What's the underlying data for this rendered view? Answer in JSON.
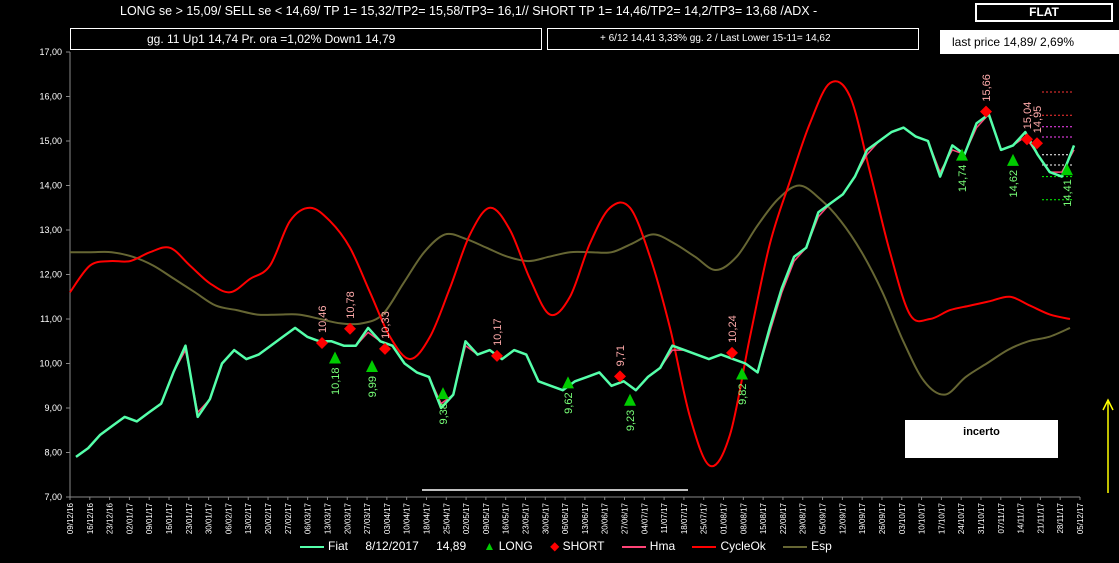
{
  "header": {
    "signal_text": "LONG se > 15,09/   SELL se < 14,69/ TP 1= 15,32/TP2= 15,58/TP3= 16,1//   SHORT  TP 1= 14,46/TP2= 14,2/TP3= 13,68 /ADX -",
    "status": "FLAT"
  },
  "info1": "gg. 11 Up1  14,74  Pr. ora =1,02%   Down1  14,79",
  "info2": "+ 6/12   14,41  3,33%  gg. 2 / Last Lower 15-11= 14,62",
  "last_price": "last price 14,89/  2,69%",
  "incerto_label": "incerto",
  "colors": {
    "price": "#55ffaa",
    "long": "#00cc00",
    "short": "#ff0000",
    "hma": "#ff4477",
    "cycleok": "#ff0000",
    "esp": "#666633",
    "long_label": "#77ff77",
    "short_label": "#ffaaaa"
  },
  "chart_data": {
    "type": "line",
    "ylim": [
      7.0,
      17.0
    ],
    "yticks": [
      "7,00",
      "8,00",
      "9,00",
      "10,00",
      "11,00",
      "12,00",
      "13,00",
      "14,00",
      "15,00",
      "16,00",
      "17,00"
    ],
    "xtick_labels": [
      "09/12/16",
      "16/12/16",
      "23/12/16",
      "02/01/17",
      "09/01/17",
      "16/01/17",
      "23/01/17",
      "30/01/17",
      "06/02/17",
      "13/02/17",
      "20/02/17",
      "27/02/17",
      "06/03/17",
      "13/03/17",
      "20/03/17",
      "27/03/17",
      "03/04/17",
      "10/04/17",
      "18/04/17",
      "25/04/17",
      "02/05/17",
      "09/05/17",
      "16/05/17",
      "23/05/17",
      "30/05/17",
      "06/06/17",
      "13/06/17",
      "20/06/17",
      "27/06/17",
      "04/07/17",
      "11/07/17",
      "18/07/17",
      "25/07/17",
      "01/08/17",
      "08/08/17",
      "15/08/17",
      "22/08/17",
      "29/08/17",
      "05/09/17",
      "12/09/17",
      "19/09/17",
      "26/09/17",
      "03/10/17",
      "10/10/17",
      "17/10/17",
      "24/10/17",
      "31/10/17",
      "07/11/17",
      "14/11/17",
      "21/11/17",
      "28/11/17",
      "05/12/17"
    ],
    "series": [
      {
        "name": "Fiat",
        "values": [
          7.9,
          8.1,
          8.4,
          8.6,
          8.8,
          8.7,
          8.9,
          9.1,
          9.8,
          10.4,
          8.8,
          9.2,
          10.0,
          10.3,
          10.1,
          10.2,
          10.4,
          10.6,
          10.8,
          10.6,
          10.5,
          10.5,
          10.4,
          10.4,
          10.8,
          10.5,
          10.4,
          10.0,
          9.8,
          9.7,
          9.0,
          9.3,
          10.5,
          10.2,
          10.3,
          10.1,
          10.3,
          10.2,
          9.6,
          9.5,
          9.4,
          9.6,
          9.7,
          9.8,
          9.5,
          9.6,
          9.4,
          9.7,
          9.9,
          10.4,
          10.3,
          10.2,
          10.1,
          10.2,
          10.1,
          10.0,
          9.8,
          10.8,
          11.7,
          12.4,
          12.6,
          13.4,
          13.6,
          13.8,
          14.2,
          14.8,
          15.0,
          15.2,
          15.3,
          15.1,
          15.0,
          14.2,
          14.9,
          14.7,
          15.4,
          15.6,
          14.8,
          14.9,
          15.2,
          14.7,
          14.3,
          14.2,
          14.9
        ]
      },
      {
        "name": "Hma",
        "values": [
          7.9,
          8.1,
          8.4,
          8.6,
          8.8,
          8.7,
          8.9,
          9.1,
          9.8,
          10.3,
          8.9,
          9.2,
          10.0,
          10.3,
          10.1,
          10.2,
          10.4,
          10.6,
          10.8,
          10.6,
          10.5,
          10.5,
          10.4,
          10.4,
          10.7,
          10.5,
          10.4,
          10.0,
          9.8,
          9.7,
          9.1,
          9.3,
          10.4,
          10.2,
          10.3,
          10.1,
          10.3,
          10.2,
          9.6,
          9.5,
          9.4,
          9.6,
          9.7,
          9.8,
          9.5,
          9.6,
          9.4,
          9.7,
          9.9,
          10.3,
          10.3,
          10.2,
          10.1,
          10.2,
          10.1,
          10.0,
          9.8,
          10.7,
          11.6,
          12.3,
          12.6,
          13.3,
          13.6,
          13.8,
          14.2,
          14.7,
          15.0,
          15.2,
          15.3,
          15.1,
          15.0,
          14.3,
          14.8,
          14.7,
          15.3,
          15.6,
          14.8,
          14.9,
          15.1,
          14.7,
          14.3,
          14.3,
          14.8
        ]
      },
      {
        "name": "CycleOk",
        "values": [
          11.6,
          12.2,
          12.3,
          12.3,
          12.5,
          12.6,
          12.2,
          11.8,
          11.6,
          11.9,
          12.2,
          13.2,
          13.5,
          13.2,
          12.6,
          11.6,
          10.6,
          10.1,
          10.6,
          11.7,
          12.9,
          13.5,
          13.0,
          11.9,
          11.1,
          11.5,
          12.7,
          13.5,
          13.5,
          12.4,
          10.8,
          8.8,
          7.7,
          8.4,
          10.6,
          12.7,
          14.1,
          15.4,
          16.3,
          16.0,
          14.3,
          12.5,
          11.1,
          11.0,
          11.2,
          11.3,
          11.4,
          11.5,
          11.3,
          11.1,
          11.0
        ]
      },
      {
        "name": "Esp",
        "values": [
          12.5,
          12.5,
          12.5,
          12.4,
          12.2,
          11.9,
          11.6,
          11.3,
          11.2,
          11.1,
          11.1,
          11.1,
          11.0,
          10.9,
          10.9,
          11.1,
          11.8,
          12.5,
          12.9,
          12.8,
          12.6,
          12.4,
          12.3,
          12.4,
          12.5,
          12.5,
          12.5,
          12.7,
          12.9,
          12.7,
          12.4,
          12.1,
          12.4,
          13.1,
          13.7,
          14.0,
          13.7,
          13.2,
          12.5,
          11.6,
          10.5,
          9.6,
          9.3,
          9.7,
          10.0,
          10.3,
          10.5,
          10.6,
          10.8
        ]
      }
    ],
    "long_signals": [
      {
        "value": 10.18,
        "label": "10,18"
      },
      {
        "value": 9.99,
        "label": "9,99"
      },
      {
        "value": 9.38,
        "label": "9,38"
      },
      {
        "value": 9.62,
        "label": "9,62"
      },
      {
        "value": 9.23,
        "label": "9,23"
      },
      {
        "value": 9.82,
        "label": "9,82"
      },
      {
        "value": 14.74,
        "label": "14,74"
      },
      {
        "value": 14.62,
        "label": "14,62"
      },
      {
        "value": 14.41,
        "label": "14,41"
      }
    ],
    "short_signals": [
      {
        "value": 10.46,
        "label": "10,46"
      },
      {
        "value": 10.78,
        "label": "10,78"
      },
      {
        "value": 10.33,
        "label": "10,33"
      },
      {
        "value": 10.17,
        "label": "10,17"
      },
      {
        "value": 9.71,
        "label": "9,71"
      },
      {
        "value": 10.24,
        "label": "10,24"
      },
      {
        "value": 15.04,
        "label": "15,04"
      },
      {
        "value": 15.66,
        "label": "15,66"
      },
      {
        "value": 14.95,
        "label": "14,95"
      }
    ],
    "legend": [
      "Fiat",
      "8/12/2017",
      "14,89",
      "LONG",
      "SHORT",
      "Hma",
      "CycleOk",
      "Esp"
    ]
  }
}
